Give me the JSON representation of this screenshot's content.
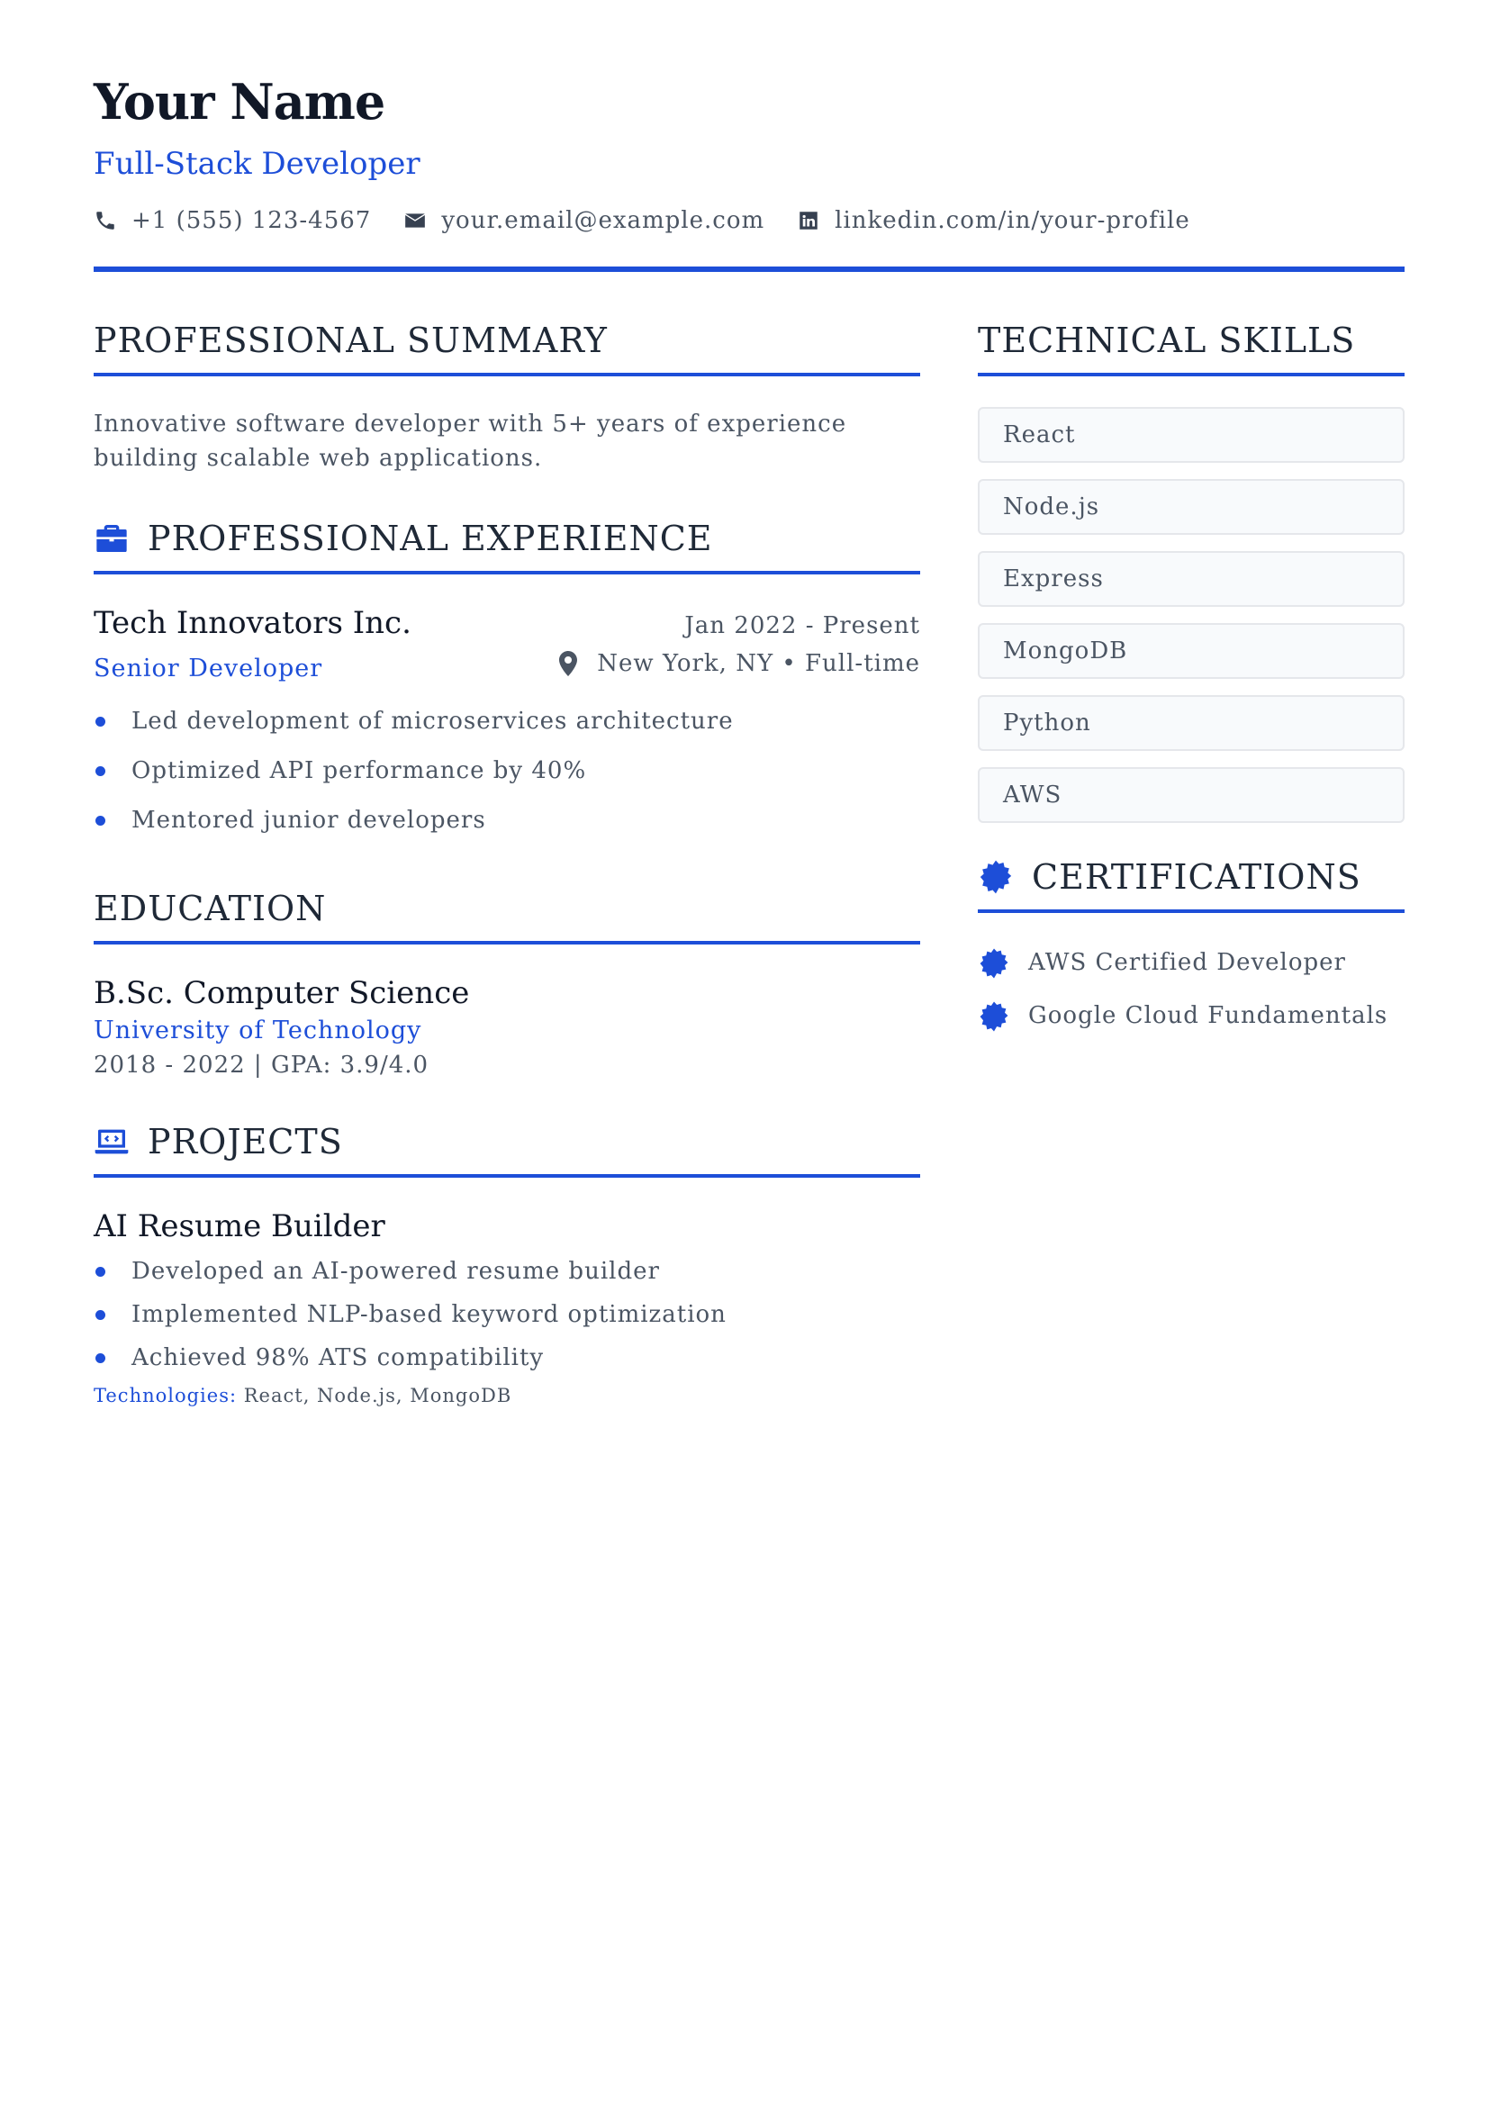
{
  "header": {
    "name": "Your Name",
    "title": "Full-Stack Developer",
    "contact": {
      "phone": "+1 (555) 123-4567",
      "email": "your.email@example.com",
      "linkedin": "linkedin.com/in/your-profile"
    }
  },
  "summary": {
    "heading": "PROFESSIONAL SUMMARY",
    "text": "Innovative software developer with 5+ years of experience building scalable web applications."
  },
  "experience": {
    "heading": "PROFESSIONAL EXPERIENCE",
    "jobs": [
      {
        "company": "Tech Innovators Inc.",
        "dates": "Jan 2022 - Present",
        "role": "Senior Developer",
        "location": "New York, NY • Full-time",
        "bullets": [
          "Led development of microservices architecture",
          "Optimized API performance by 40%",
          "Mentored junior developers"
        ]
      }
    ]
  },
  "education": {
    "heading": "EDUCATION",
    "entries": [
      {
        "degree": "B.Sc. Computer Science",
        "school": "University of Technology",
        "meta": "2018 - 2022 | GPA: 3.9/4.0"
      }
    ]
  },
  "projects": {
    "heading": "PROJECTS",
    "items": [
      {
        "title": "AI Resume Builder",
        "bullets": [
          "Developed an AI-powered resume builder",
          "Implemented NLP-based keyword optimization",
          "Achieved 98% ATS compatibility"
        ],
        "tech_label": "Technologies:",
        "tech_list": "React, Node.js, MongoDB"
      }
    ]
  },
  "skills": {
    "heading": "TECHNICAL SKILLS",
    "items": [
      "React",
      "Node.js",
      "Express",
      "MongoDB",
      "Python",
      "AWS"
    ]
  },
  "certifications": {
    "heading": "CERTIFICATIONS",
    "items": [
      "AWS Certified Developer",
      "Google Cloud Fundamentals"
    ]
  },
  "colors": {
    "accent": "#1d4ed8",
    "text": "#1f2937",
    "muted": "#4b5563"
  },
  "icons": {
    "phone": "phone-icon",
    "email": "envelope-icon",
    "linkedin": "linkedin-icon",
    "experience": "briefcase-icon",
    "location": "map-pin-icon",
    "projects": "laptop-code-icon",
    "certifications": "certificate-badge-icon"
  }
}
